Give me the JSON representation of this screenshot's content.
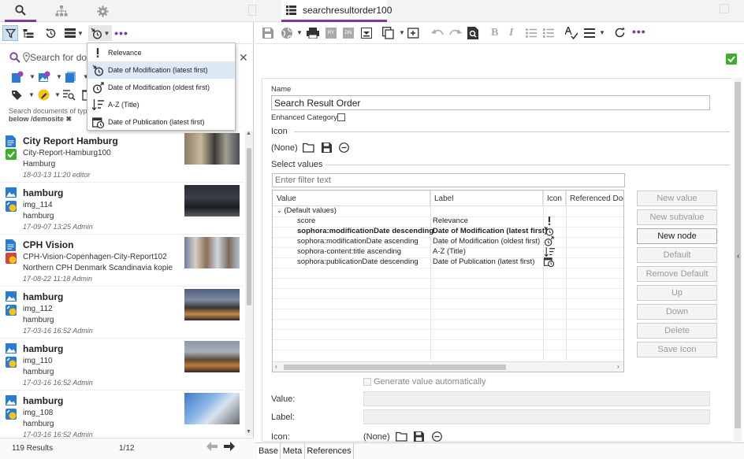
{
  "left_tabs": {
    "search": "search-icon",
    "tree": "sitemap-icon",
    "settings": "gear-icon"
  },
  "search": {
    "placeholder": "Search for documents",
    "value": "Search for do"
  },
  "filter_note": {
    "line1": "Search documents of type",
    "line2": "below /demosite"
  },
  "sort_menu": {
    "items": [
      {
        "label": "Relevance",
        "icon": "exclamation-icon",
        "selected": false
      },
      {
        "label": "Date of Modification (latest first)",
        "icon": "clock-down-icon",
        "selected": true
      },
      {
        "label": "Date of Modification (oldest first)",
        "icon": "clock-up-icon",
        "selected": false
      },
      {
        "label": "A-Z (Title)",
        "icon": "sort-alpha-icon",
        "selected": false
      },
      {
        "label": "Date of Publication (latest first)",
        "icon": "calendar-clock-icon",
        "selected": false
      }
    ]
  },
  "results": [
    {
      "title": "City Report Hamburg",
      "line1": "City-Report-Hamburg100",
      "line2": "Hamburg",
      "meta": "18-03-13 11:20 editor",
      "type": "article",
      "status": "approved"
    },
    {
      "title": "hamburg",
      "line1": "img_114",
      "line2": "hamburg",
      "meta": "17-09-07 13:25 Admin",
      "type": "picture",
      "status": "published"
    },
    {
      "title": "CPH Vision",
      "line1": "CPH-Vision-Copenhagen-City-Report102",
      "line2": "Northern CPH Denmark Scandinavia kopie",
      "meta": "17-08-22 11:18 Admin",
      "type": "article",
      "status": "checked-out"
    },
    {
      "title": "hamburg",
      "line1": "img_112",
      "line2": "hamburg",
      "meta": "17-03-16 16:52 Admin",
      "type": "picture",
      "status": "published"
    },
    {
      "title": "hamburg",
      "line1": "img_110",
      "line2": "hamburg",
      "meta": "17-03-16 16:52 Admin",
      "type": "picture",
      "status": "published"
    },
    {
      "title": "hamburg",
      "line1": "img_108",
      "line2": "hamburg",
      "meta": "17-03-16 16:52 Admin",
      "type": "picture",
      "status": "published"
    }
  ],
  "footer": {
    "count": "119 Results",
    "page": "1/12"
  },
  "doc": {
    "tab_title": "searchresultorder100",
    "name_label": "Name",
    "name_value": "Search Result Order",
    "enhanced_label": "Enhanced Category",
    "icon_section": "Icon",
    "icon_none": "(None)",
    "select_values": "Select values",
    "filter_placeholder": "Enter filter text",
    "table": {
      "headers": [
        "Value",
        "Label",
        "Icon",
        "Referenced Docu"
      ],
      "group": "(Default values)",
      "rows": [
        {
          "value": "score",
          "label": "Relevance",
          "bold": false,
          "icon": "exclamation-icon"
        },
        {
          "value": "sophora:modificationDate descending",
          "label": "Date of Modification (latest first)",
          "bold": true,
          "icon": "clock-down-icon"
        },
        {
          "value": "sophora:modificationDate ascending",
          "label": "Date of Modification (oldest first)",
          "bold": false,
          "icon": "clock-up-icon"
        },
        {
          "value": "sophora-content:title ascending",
          "label": "A-Z (Title)",
          "bold": false,
          "icon": "sort-alpha-icon"
        },
        {
          "value": "sophora:publicationDate descending",
          "label": "Date of Publication (latest first)",
          "bold": false,
          "icon": "calendar-clock-icon"
        }
      ]
    },
    "buttons": {
      "new_value": "New value",
      "new_subvalue": "New subvalue",
      "new_node": "New node",
      "default": "Default",
      "remove_default": "Remove Default",
      "up": "Up",
      "down": "Down",
      "delete": "Delete",
      "save_icon": "Save Icon"
    },
    "generate_auto": "Generate value automatically",
    "value_label": "Value:",
    "label_label": "Label:",
    "icon_label": "Icon:",
    "icon_none2": "(None)"
  },
  "bottom_tabs": [
    "Base",
    "Meta",
    "References"
  ],
  "colors": {
    "accent": "#7b3d9c",
    "blue": "#2a7bd4",
    "ok": "#3dae2b"
  }
}
